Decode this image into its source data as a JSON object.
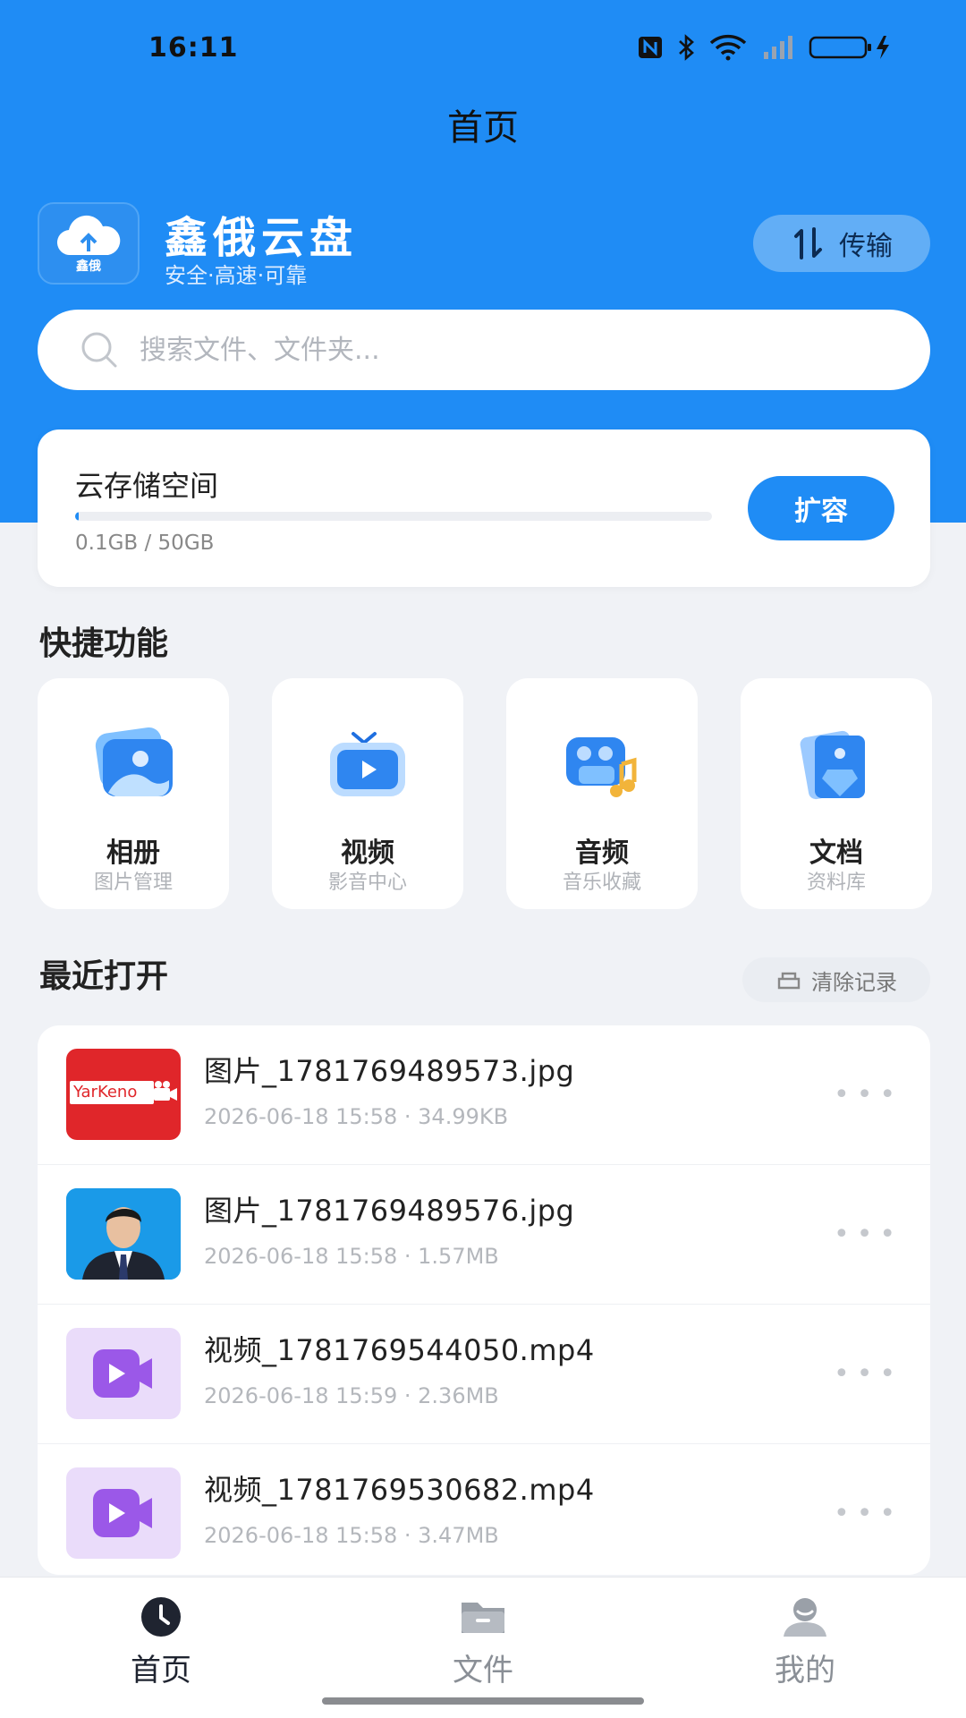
{
  "status_bar": {
    "time": "16:11"
  },
  "header": {
    "title": "首页"
  },
  "brand": {
    "logo_text": "鑫俄",
    "name": "鑫俄云盘",
    "slogan": "安全·高速·可靠"
  },
  "transfer": {
    "label": "传输"
  },
  "search": {
    "placeholder": "搜索文件、文件夹..."
  },
  "storage": {
    "title": "云存储空间",
    "usage_text": "0.1GB / 50GB",
    "used_fraction": 0.002,
    "expand_label": "扩容"
  },
  "quick": {
    "title": "快捷功能",
    "items": [
      {
        "title": "相册",
        "subtitle": "图片管理",
        "icon": "photo-album-icon"
      },
      {
        "title": "视频",
        "subtitle": "影音中心",
        "icon": "tv-video-icon"
      },
      {
        "title": "音频",
        "subtitle": "音乐收藏",
        "icon": "music-camera-icon"
      },
      {
        "title": "文档",
        "subtitle": "资料库",
        "icon": "document-icon"
      }
    ]
  },
  "recent": {
    "title": "最近打开",
    "clear_label": "清除记录",
    "files": [
      {
        "name": "图片_1781769489573.jpg",
        "meta": "2026-06-18 15:58 · 34.99KB",
        "thumb": "image",
        "thumb_text": "YarKeno"
      },
      {
        "name": "图片_1781769489576.jpg",
        "meta": "2026-06-18 15:58 · 1.57MB",
        "thumb": "portrait"
      },
      {
        "name": "视频_1781769544050.mp4",
        "meta": "2026-06-18 15:59 · 2.36MB",
        "thumb": "video"
      },
      {
        "name": "视频_1781769530682.mp4",
        "meta": "2026-06-18 15:58 · 3.47MB",
        "thumb": "video"
      }
    ]
  },
  "nav": {
    "items": [
      {
        "label": "首页",
        "icon": "clock-icon",
        "active": true
      },
      {
        "label": "文件",
        "icon": "folder-icon",
        "active": false
      },
      {
        "label": "我的",
        "icon": "user-icon",
        "active": false
      }
    ]
  },
  "colors": {
    "primary": "#1f8cf5",
    "background": "#f0f2f6"
  }
}
